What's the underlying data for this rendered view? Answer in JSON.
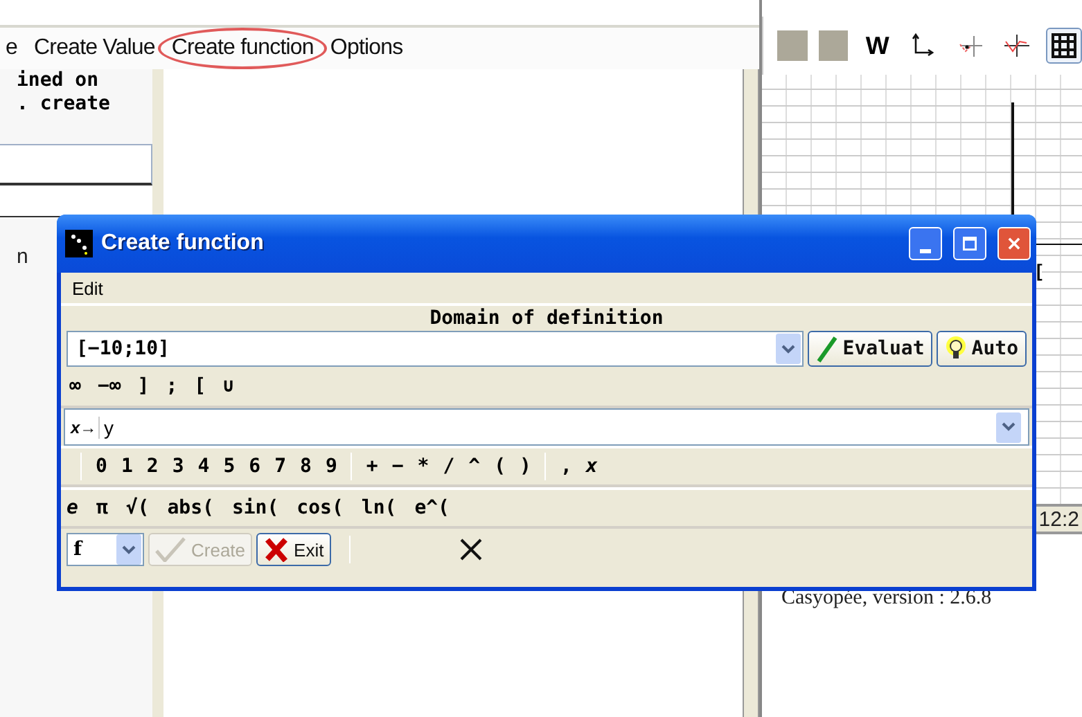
{
  "menu": [
    {
      "label": "e",
      "highlighted": false
    },
    {
      "label": "Create Value",
      "highlighted": false
    },
    {
      "label": "Create function",
      "highlighted": true
    },
    {
      "label": "Options",
      "highlighted": false
    }
  ],
  "left_panel": {
    "lines": [
      "ined on",
      ". create"
    ],
    "label": "n"
  },
  "graph_toolbar": [
    {
      "kind": "swatch",
      "selected": false
    },
    {
      "kind": "swatch",
      "selected": false
    },
    {
      "kind": "text",
      "label": "W",
      "selected": false
    },
    {
      "kind": "axes",
      "selected": false
    },
    {
      "kind": "curve-point",
      "selected": false
    },
    {
      "kind": "curve",
      "selected": false
    },
    {
      "kind": "grid",
      "selected": true
    }
  ],
  "graph": {
    "side_text": "[",
    "time": "12:2"
  },
  "version": "Casyopée, version : 2.6.8",
  "dialog": {
    "title": "Create function",
    "menu": [
      "Edit"
    ],
    "domain": {
      "heading": "Domain of definition",
      "value": "[−10;10]",
      "buttons": [
        {
          "kind": "evaluate",
          "label": "Evaluat"
        },
        {
          "kind": "auto",
          "label": "Auto"
        }
      ],
      "symbols": [
        "∞",
        "−∞",
        "]",
        ";",
        "[",
        "∪"
      ]
    },
    "function": {
      "prefix": "x→",
      "value": "y"
    },
    "key_groups": [
      [
        "0",
        "1",
        "2",
        "3",
        "4",
        "5",
        "6",
        "7",
        "8",
        "9"
      ],
      [
        "+",
        "−",
        "*",
        "/",
        "^",
        "(",
        ")"
      ],
      [
        ",",
        "x"
      ]
    ],
    "function_keys": [
      "e",
      "π",
      "√(",
      "abs(",
      "sin(",
      "cos(",
      "ln(",
      "e^("
    ],
    "footer": {
      "name": "f",
      "buttons": [
        {
          "kind": "create",
          "label": "Create",
          "disabled": true
        },
        {
          "kind": "exit",
          "label": "Exit",
          "disabled": false
        }
      ]
    }
  }
}
